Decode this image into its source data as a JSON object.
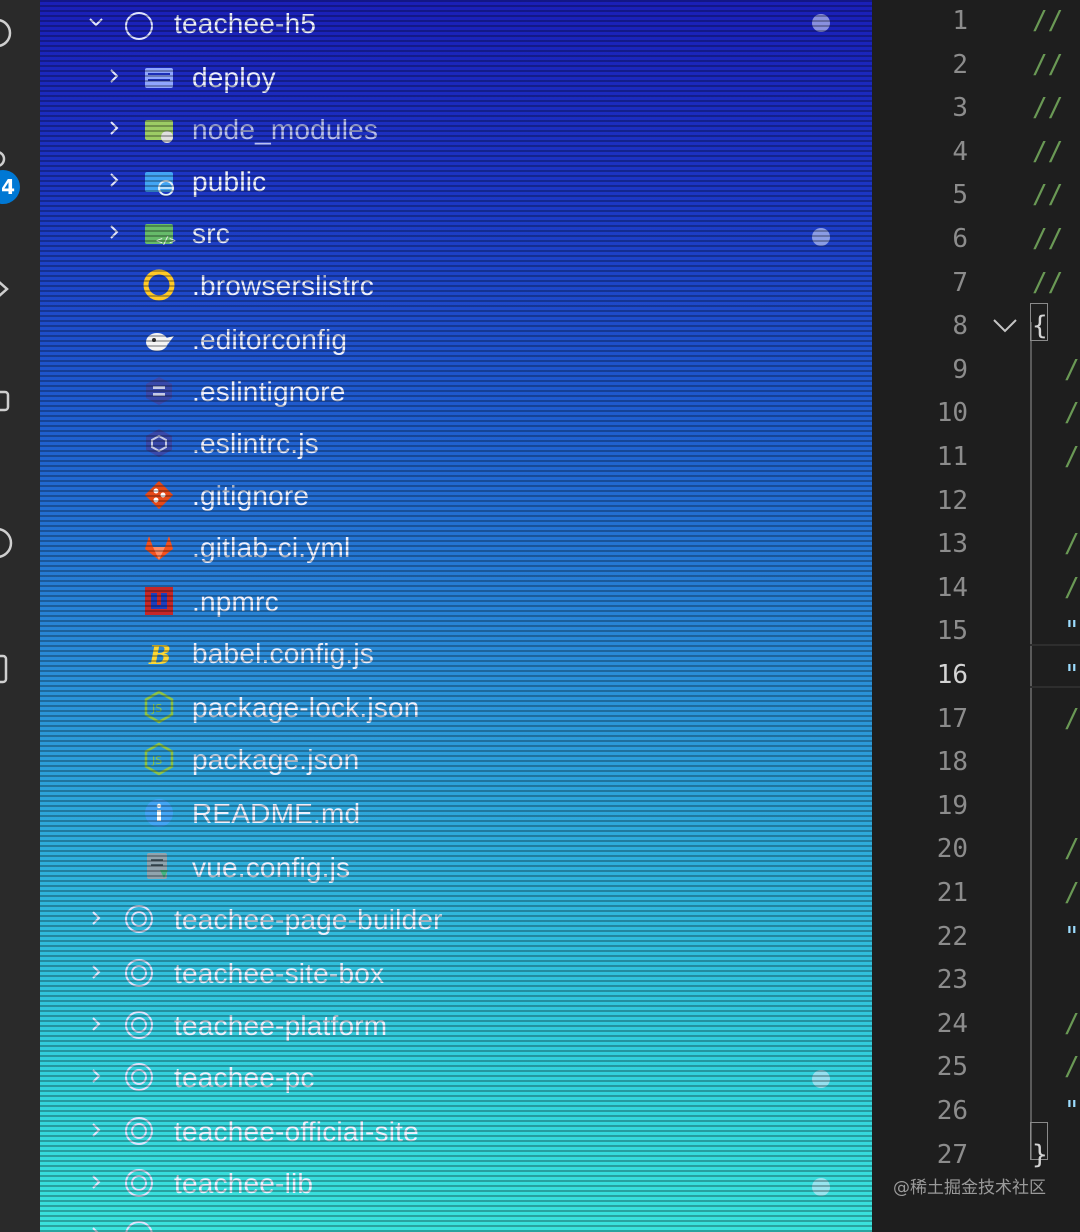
{
  "activity_bar": {
    "badge_count": "4",
    "icons": [
      "source-control-icon",
      "debug-icon",
      "extensions-icon",
      "account-icon",
      "remote-icon"
    ]
  },
  "explorer": {
    "items": [
      {
        "label": "teachee-h5",
        "kind": "root-folder",
        "expanded": true,
        "icon": "folder-root-icon"
      },
      {
        "label": "deploy",
        "kind": "folder",
        "expanded": false,
        "icon": "folder-icon"
      },
      {
        "label": "node_modules",
        "kind": "folder",
        "expanded": false,
        "icon": "folder-node-icon"
      },
      {
        "label": "public",
        "kind": "folder",
        "expanded": false,
        "icon": "folder-public-icon"
      },
      {
        "label": "src",
        "kind": "folder",
        "expanded": false,
        "icon": "folder-src-icon"
      },
      {
        "label": ".browserslistrc",
        "kind": "file",
        "icon": "browserslist-icon"
      },
      {
        "label": ".editorconfig",
        "kind": "file",
        "icon": "editorconfig-icon"
      },
      {
        "label": ".eslintignore",
        "kind": "file",
        "icon": "eslint-icon"
      },
      {
        "label": ".eslintrc.js",
        "kind": "file",
        "icon": "eslint-icon"
      },
      {
        "label": ".gitignore",
        "kind": "file",
        "icon": "git-icon"
      },
      {
        "label": ".gitlab-ci.yml",
        "kind": "file",
        "icon": "gitlab-icon"
      },
      {
        "label": ".npmrc",
        "kind": "file",
        "icon": "npm-icon"
      },
      {
        "label": "babel.config.js",
        "kind": "file",
        "icon": "babel-icon"
      },
      {
        "label": "package-lock.json",
        "kind": "file",
        "icon": "nodejs-icon"
      },
      {
        "label": "package.json",
        "kind": "file",
        "icon": "nodejs-icon"
      },
      {
        "label": "README.md",
        "kind": "file",
        "icon": "info-icon"
      },
      {
        "label": "vue.config.js",
        "kind": "file",
        "icon": "vue-config-icon"
      },
      {
        "label": "teachee-page-builder",
        "kind": "root-folder",
        "expanded": false,
        "icon": "folder-root-icon"
      },
      {
        "label": "teachee-site-box",
        "kind": "root-folder",
        "expanded": false,
        "icon": "folder-root-icon"
      },
      {
        "label": "teachee-platform",
        "kind": "root-folder",
        "expanded": false,
        "icon": "folder-root-icon"
      },
      {
        "label": "teachee-pc",
        "kind": "root-folder",
        "expanded": false,
        "icon": "folder-root-icon"
      },
      {
        "label": "teachee-official-site",
        "kind": "root-folder",
        "expanded": false,
        "icon": "folder-root-icon"
      },
      {
        "label": "teachee-lib",
        "kind": "root-folder",
        "expanded": false,
        "icon": "folder-root-icon"
      },
      {
        "label": "",
        "kind": "root-folder",
        "expanded": false,
        "icon": "folder-root-icon"
      }
    ]
  },
  "editor": {
    "active_line": "16",
    "lines": [
      {
        "n": "1",
        "text": "//",
        "type": "comment"
      },
      {
        "n": "2",
        "text": "//",
        "type": "comment"
      },
      {
        "n": "3",
        "text": "//",
        "type": "comment"
      },
      {
        "n": "4",
        "text": "//",
        "type": "comment"
      },
      {
        "n": "5",
        "text": "//",
        "type": "comment"
      },
      {
        "n": "6",
        "text": "//",
        "type": "comment"
      },
      {
        "n": "7",
        "text": "//",
        "type": "comment"
      },
      {
        "n": "8",
        "text": "{",
        "type": "brace"
      },
      {
        "n": "9",
        "text": "/",
        "type": "comment"
      },
      {
        "n": "10",
        "text": "/",
        "type": "comment"
      },
      {
        "n": "11",
        "text": "/",
        "type": "comment"
      },
      {
        "n": "12",
        "text": "",
        "type": "empty"
      },
      {
        "n": "13",
        "text": "/",
        "type": "comment"
      },
      {
        "n": "14",
        "text": "/",
        "type": "comment"
      },
      {
        "n": "15",
        "text": "\"",
        "type": "string"
      },
      {
        "n": "16",
        "text": "\"",
        "type": "string"
      },
      {
        "n": "17",
        "text": "/",
        "type": "comment"
      },
      {
        "n": "18",
        "text": "",
        "type": "empty"
      },
      {
        "n": "19",
        "text": "",
        "type": "empty"
      },
      {
        "n": "20",
        "text": "/",
        "type": "comment"
      },
      {
        "n": "21",
        "text": "/",
        "type": "comment"
      },
      {
        "n": "22",
        "text": "\"",
        "type": "string"
      },
      {
        "n": "23",
        "text": "",
        "type": "empty"
      },
      {
        "n": "24",
        "text": "/",
        "type": "comment"
      },
      {
        "n": "25",
        "text": "/",
        "type": "comment"
      },
      {
        "n": "26",
        "text": "\"",
        "type": "string"
      },
      {
        "n": "27",
        "text": "}",
        "type": "brace"
      }
    ]
  },
  "watermark": "@稀土掘金技术社区",
  "colors": {
    "explorer_top": "#1a1fb8",
    "explorer_bottom": "#3ae2dc",
    "editor_bg": "#1e1e1e",
    "badge": "#0078d4",
    "comment": "#6a9955",
    "string": "#9cdcfe"
  }
}
